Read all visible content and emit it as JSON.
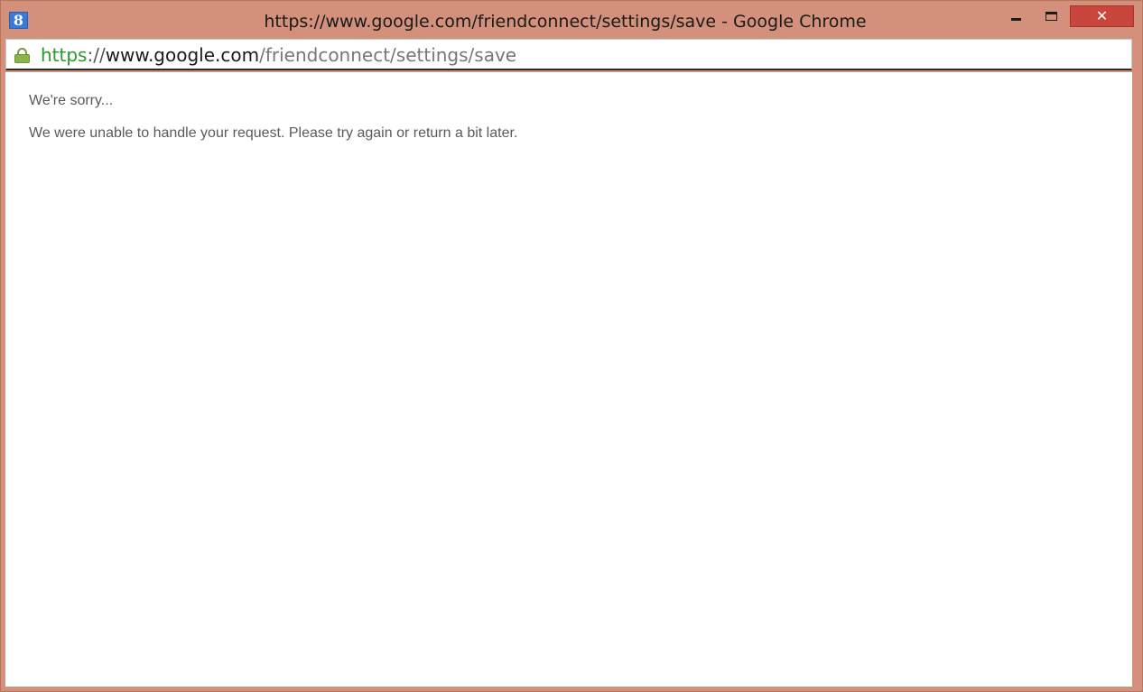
{
  "window": {
    "title": "https://www.google.com/friendconnect/settings/save - Google Chrome",
    "app_icon_glyph": "8",
    "app_icon": "google-icon",
    "controls": {
      "minimize": "minimize-icon",
      "maximize": "maximize-icon",
      "close_glyph": "✕"
    },
    "colors": {
      "frame": "#d3907b",
      "close": "#c9463d"
    }
  },
  "addressbar": {
    "lock_icon": "lock-icon",
    "url_scheme": "https",
    "url_separator": "://",
    "url_host": "www.google.com",
    "url_path": "/friendconnect/settings/save",
    "colors": {
      "scheme": "#2a9a2a",
      "host": "#1a1a1a",
      "path": "#777777"
    }
  },
  "content": {
    "heading": "We're sorry...",
    "message": "We were unable to handle your request. Please try again or return a bit later."
  }
}
